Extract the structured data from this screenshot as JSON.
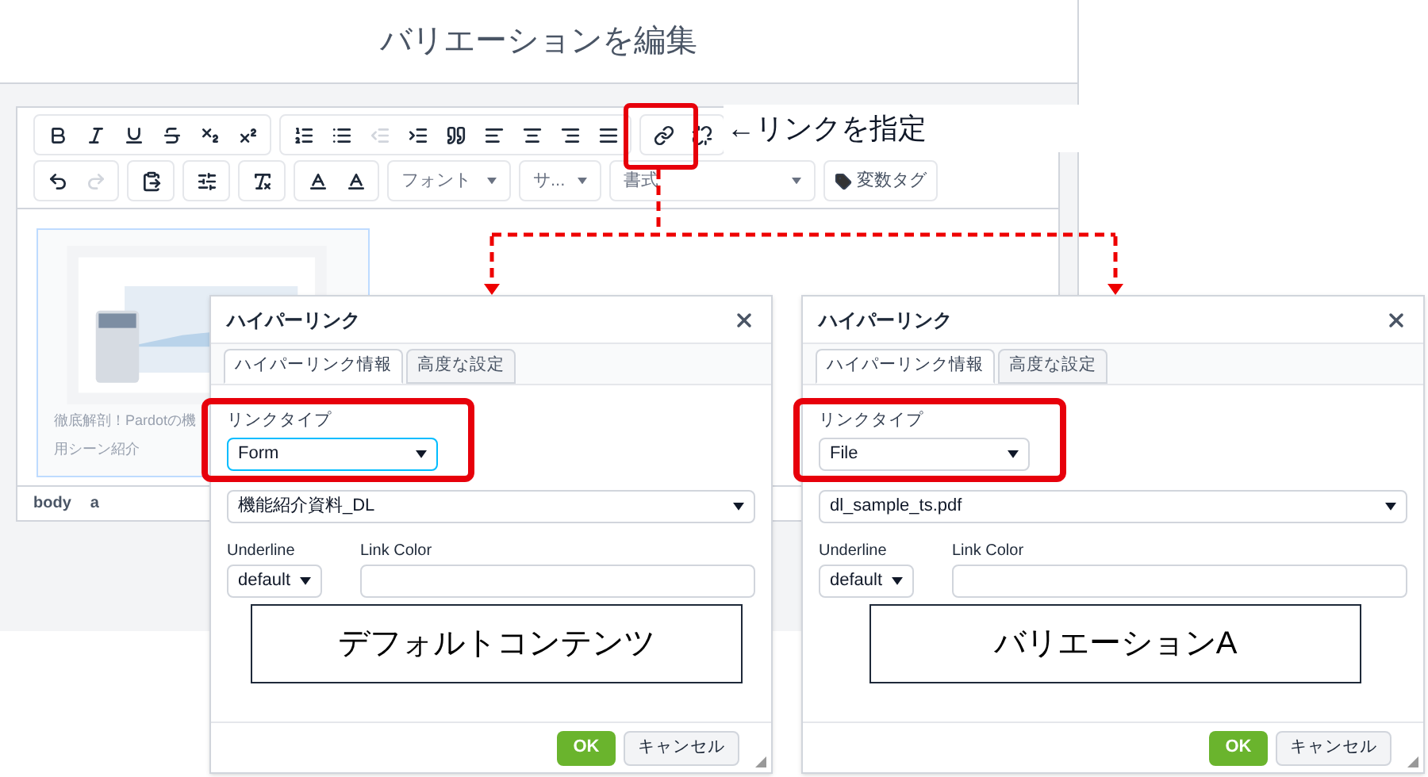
{
  "page_title": "バリエーションを編集",
  "toolbar": {
    "outdent_disabled": true,
    "redo_disabled": true,
    "dropdowns": [
      {
        "label": "フォント"
      },
      {
        "label": "サ..."
      },
      {
        "label": "書式"
      }
    ],
    "variable_tag": "変数タグ"
  },
  "content_card": {
    "lines": [
      "徹底解剖！Pardotの機",
      "用シーン紹介"
    ]
  },
  "status_path": [
    "body",
    "a"
  ],
  "annotation": "←リンクを指定",
  "dialogs": [
    {
      "title": "ハイパーリンク",
      "tabs": [
        {
          "label": "ハイパーリンク情報",
          "selected": true
        },
        {
          "label": "高度な設定",
          "selected": false
        }
      ],
      "link_type_label": "リンクタイプ",
      "link_type_value": "Form",
      "target_value": "機能紹介資料_DL",
      "underline_label": "Underline",
      "underline_value": "default",
      "link_color_label": "Link Color",
      "ok": "OK",
      "cancel": "キャンセル",
      "caption": "デフォルトコンテンツ"
    },
    {
      "title": "ハイパーリンク",
      "tabs": [
        {
          "label": "ハイパーリンク情報",
          "selected": true
        },
        {
          "label": "高度な設定",
          "selected": false
        }
      ],
      "link_type_label": "リンクタイプ",
      "link_type_value": "File",
      "target_value": "dl_sample_ts.pdf",
      "underline_label": "Underline",
      "underline_value": "default",
      "link_color_label": "Link Color",
      "ok": "OK",
      "cancel": "キャンセル",
      "caption": "バリエーションA"
    }
  ]
}
